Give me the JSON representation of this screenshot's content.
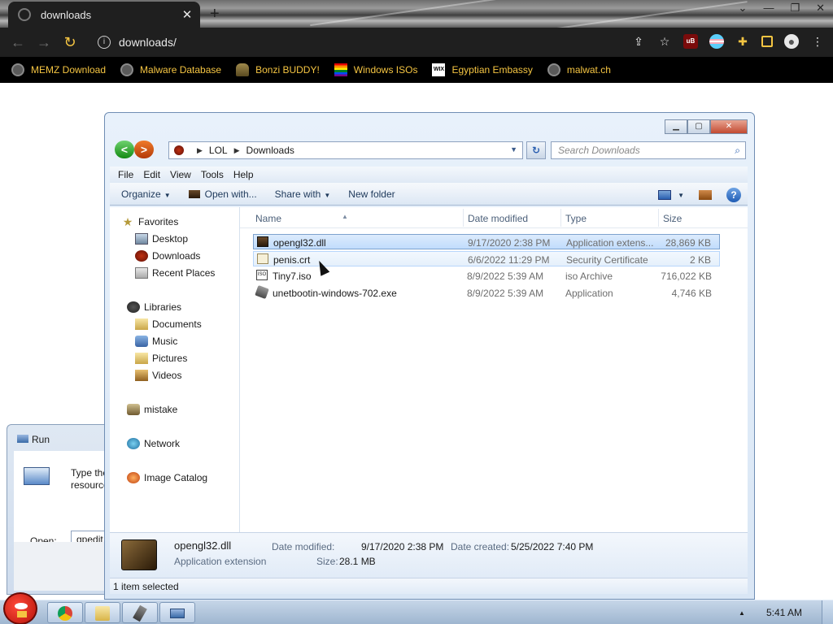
{
  "browser": {
    "tab_title": "downloads",
    "address": "downloads/",
    "bookmarks": [
      {
        "label": "MEMZ Download",
        "icon": "globe-icon"
      },
      {
        "label": "Malware Database",
        "icon": "globe-icon"
      },
      {
        "label": "Bonzi BUDDY!",
        "icon": "bonzi-icon"
      },
      {
        "label": "Windows ISOs",
        "icon": "rainbow-icon"
      },
      {
        "label": "Egyptian Embassy",
        "icon": "wix-icon"
      },
      {
        "label": "malwat.ch",
        "icon": "globe-icon"
      }
    ],
    "wix_text": "WIX",
    "ublock_text": "uB",
    "accent_color": "#f5c542"
  },
  "explorer": {
    "breadcrumb": [
      "LOL",
      "Downloads"
    ],
    "search_placeholder": "Search Downloads",
    "menu": [
      "File",
      "Edit",
      "View",
      "Tools",
      "Help"
    ],
    "commands": {
      "organize": "Organize",
      "open_with": "Open with...",
      "share_with": "Share with",
      "new_folder": "New folder"
    },
    "help_glyph": "?",
    "nav": {
      "favorites": "Favorites",
      "desktop": "Desktop",
      "downloads": "Downloads",
      "recent": "Recent Places",
      "libraries": "Libraries",
      "documents": "Documents",
      "music": "Music",
      "pictures": "Pictures",
      "videos": "Videos",
      "user": "mistake",
      "network": "Network",
      "image_catalog": "Image Catalog"
    },
    "columns": [
      "Name",
      "Date modified",
      "Type",
      "Size"
    ],
    "files": [
      {
        "name": "opengl32.dll",
        "date": "9/17/2020 2:38 PM",
        "type": "Application extens...",
        "size": "28,869 KB",
        "icon": "dll-icon",
        "selected": true
      },
      {
        "name": "penis.crt",
        "date": "6/6/2022 11:29 PM",
        "type": "Security Certificate",
        "size": "2 KB",
        "icon": "certificate-icon",
        "hovered": true
      },
      {
        "name": "Tiny7.iso",
        "date": "8/9/2022 5:39 AM",
        "type": "iso Archive",
        "size": "716,022 KB",
        "icon": "iso-icon"
      },
      {
        "name": "unetbootin-windows-702.exe",
        "date": "8/9/2022 5:39 AM",
        "type": "Application",
        "size": "4,746 KB",
        "icon": "exe-icon"
      }
    ],
    "iso_text": "ISO",
    "details": {
      "name": "opengl32.dll",
      "type": "Application extension",
      "modified_label": "Date modified:",
      "modified_value": "9/17/2020 2:38 PM",
      "created_label": "Date created:",
      "created_value": "5/25/2022 7:40 PM",
      "size_label": "Size:",
      "size_value": "28.1 MB"
    },
    "status": "1 item selected"
  },
  "run_dialog": {
    "title": "Run",
    "desc_line1": "Type the",
    "desc_line2": "resource,",
    "open_label": "Open:",
    "input_value": "gpedit.m"
  },
  "taskbar": {
    "clock": "5:41 AM"
  }
}
